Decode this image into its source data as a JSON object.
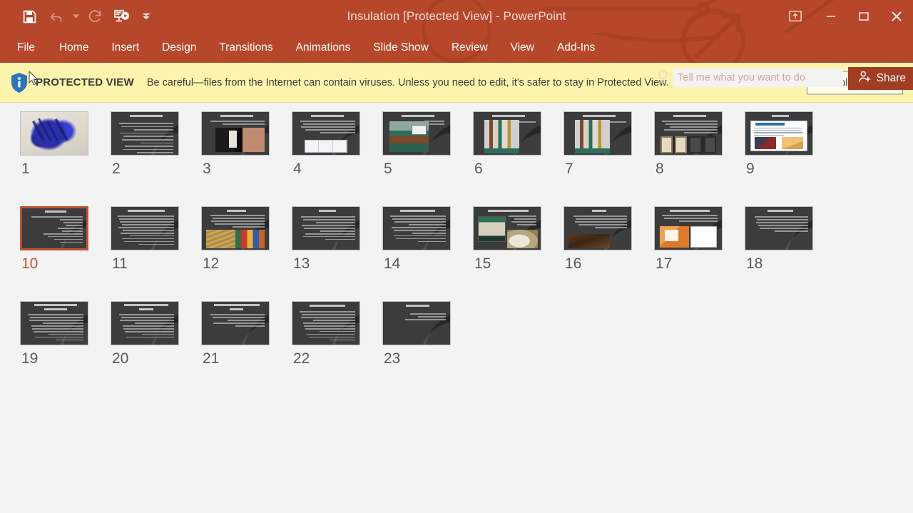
{
  "window": {
    "title": "Insulation [Protected View] - PowerPoint",
    "accent_color": "#b7472a",
    "share_label": "Share",
    "controls": {
      "ribbon_display_options": "ribbon-display-options",
      "minimize": "minimize",
      "restore": "restore",
      "close": "close"
    }
  },
  "quick_access": [
    {
      "name": "save",
      "icon": "save-icon",
      "enabled": true
    },
    {
      "name": "undo",
      "icon": "undo-icon",
      "enabled": false
    },
    {
      "name": "redo",
      "icon": "redo-icon",
      "enabled": false
    },
    {
      "name": "start-from-beginning",
      "icon": "slideshow-icon",
      "enabled": true
    },
    {
      "name": "customize-quick-access-toolbar",
      "icon": "chevron-down-icon",
      "enabled": true
    }
  ],
  "ribbon": {
    "tabs": [
      {
        "label": "File"
      },
      {
        "label": "Home"
      },
      {
        "label": "Insert"
      },
      {
        "label": "Design"
      },
      {
        "label": "Transitions"
      },
      {
        "label": "Animations"
      },
      {
        "label": "Slide Show"
      },
      {
        "label": "Review"
      },
      {
        "label": "View"
      },
      {
        "label": "Add-Ins"
      }
    ],
    "tell_me": {
      "placeholder": "Tell me what you want to do",
      "value": ""
    }
  },
  "protected_view": {
    "label": "PROTECTED VIEW",
    "message": "Be careful—files from the Internet can contain viruses. Unless you need to edit, it's safer to stay in Protected View.",
    "button": "Enable Editing",
    "bar_color": "#fcf4ad",
    "shield_color": "#2e75b6"
  },
  "slide_sorter": {
    "selected_slide": 10,
    "selected_color": "#c0512e",
    "slides": [
      {
        "number": "1",
        "style": "cover-image"
      },
      {
        "number": "2",
        "style": "text"
      },
      {
        "number": "3",
        "style": "sound-diagram"
      },
      {
        "number": "4",
        "style": "text-with-strip"
      },
      {
        "number": "5",
        "style": "board-photo"
      },
      {
        "number": "6",
        "style": "wall-section"
      },
      {
        "number": "7",
        "style": "wall-section"
      },
      {
        "number": "8",
        "style": "windows-photo"
      },
      {
        "number": "9",
        "style": "document-page"
      },
      {
        "number": "10",
        "style": "bullet-list"
      },
      {
        "number": "11",
        "style": "text"
      },
      {
        "number": "12",
        "style": "materials-photo"
      },
      {
        "number": "13",
        "style": "text"
      },
      {
        "number": "14",
        "style": "text"
      },
      {
        "number": "15",
        "style": "rockwool-photo"
      },
      {
        "number": "16",
        "style": "rock-photo"
      },
      {
        "number": "17",
        "style": "orange-diagram"
      },
      {
        "number": "18",
        "style": "text"
      },
      {
        "number": "19",
        "style": "text"
      },
      {
        "number": "20",
        "style": "text"
      },
      {
        "number": "21",
        "style": "text"
      },
      {
        "number": "22",
        "style": "text"
      },
      {
        "number": "23",
        "style": "bullet-list"
      }
    ]
  }
}
